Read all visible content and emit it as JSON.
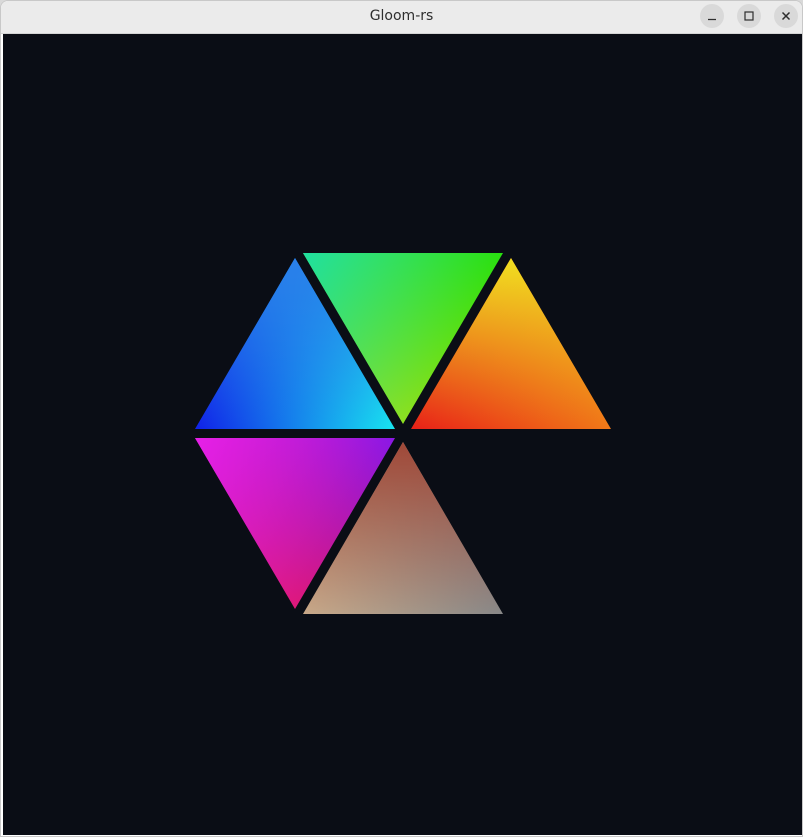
{
  "window": {
    "title": "Gloom-rs",
    "buttons": {
      "minimize_icon": "minimize-icon",
      "maximize_icon": "maximize-icon",
      "close_icon": "close-icon"
    }
  },
  "scene": {
    "background_color": "#0a0d15",
    "triangles": [
      {
        "name": "blue-cyan",
        "colors": [
          "#2a80ea",
          "#1020e8",
          "#18e6f0"
        ]
      },
      {
        "name": "green",
        "colors": [
          "#20e0a0",
          "#28e010",
          "#90e020"
        ]
      },
      {
        "name": "yellow-red",
        "colors": [
          "#f0e020",
          "#e82018",
          "#f07818"
        ]
      },
      {
        "name": "magenta",
        "colors": [
          "#e620e8",
          "#8a18e6",
          "#e01878"
        ]
      },
      {
        "name": "brown-gray",
        "colors": [
          "#a04838",
          "#c8a888",
          "#888888"
        ]
      }
    ]
  }
}
